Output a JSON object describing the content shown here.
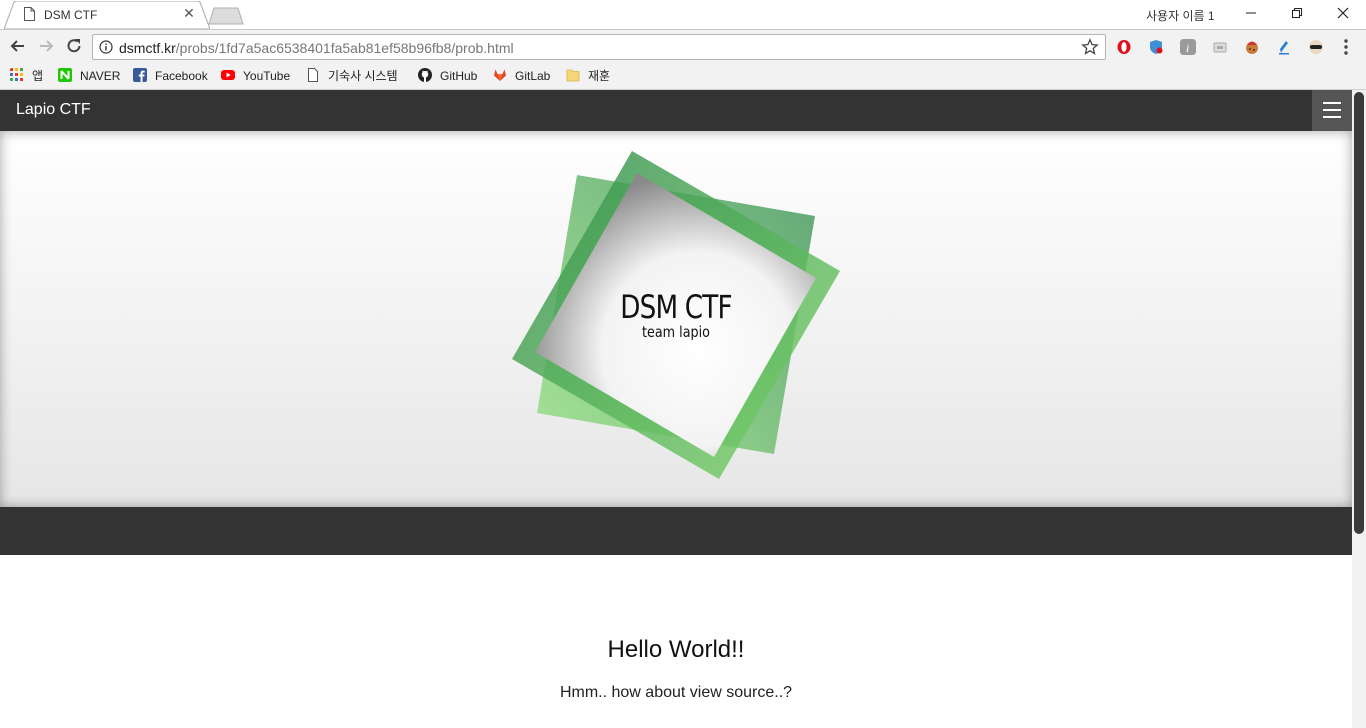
{
  "browser": {
    "tab_title": "DSM CTF",
    "profile_name": "사용자 이름 1",
    "url_host": "dsmctf.kr",
    "url_path": "/probs/1fd7a5ac6538401fa5ab81ef58b96fb8/prob.html",
    "bookmarks": [
      {
        "label": "앱",
        "icon": "apps-grid-icon"
      },
      {
        "label": "NAVER",
        "icon": "naver-icon",
        "color": "#1ec800"
      },
      {
        "label": "Facebook",
        "icon": "facebook-icon",
        "color": "#3b5998"
      },
      {
        "label": "YouTube",
        "icon": "youtube-icon",
        "color": "#ff0000"
      },
      {
        "label": "기숙사 시스템",
        "icon": "page-icon"
      },
      {
        "label": "GitHub",
        "icon": "github-icon",
        "color": "#222222"
      },
      {
        "label": "GitLab",
        "icon": "gitlab-icon",
        "color": "#e24329"
      },
      {
        "label": "재훈",
        "icon": "folder-icon",
        "color": "#f6d776"
      }
    ]
  },
  "site": {
    "brand": "Lapio CTF",
    "logo_title": "DSM CTF",
    "logo_subtitle": "team lapio",
    "heading": "Hello World!!",
    "paragraph": "Hmm.. how about view source..?"
  },
  "colors": {
    "navbar": "#333333",
    "logo_green_dark": "#2e8b4a",
    "logo_green_light": "#7fd66b"
  }
}
